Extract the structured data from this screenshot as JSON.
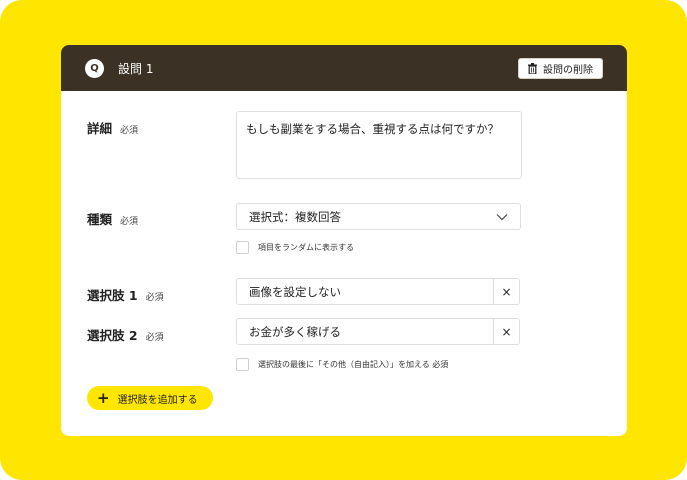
{
  "header": {
    "badge": "Q",
    "title": "設問 1",
    "delete_label": "設問の削除"
  },
  "detail": {
    "label": "詳細",
    "required": "必須",
    "value": "もしも副業をする場合、重視する点は何ですか？"
  },
  "type": {
    "label": "種類",
    "required": "必須",
    "value": "選択式：複数回答",
    "random_label": "項目をランダムに表示する"
  },
  "choices": [
    {
      "label": "選択肢 1",
      "required": "必須",
      "value": "画像を設定しない",
      "remove": "×"
    },
    {
      "label": "選択肢 2",
      "required": "必須",
      "value": "お金が多く稼げる",
      "remove": "×"
    }
  ],
  "other_option_label": "選択肢の最後に「その他（自由記入）」を加える 必須",
  "add_choice_label": "選択肢を追加する",
  "add_icon": "+"
}
